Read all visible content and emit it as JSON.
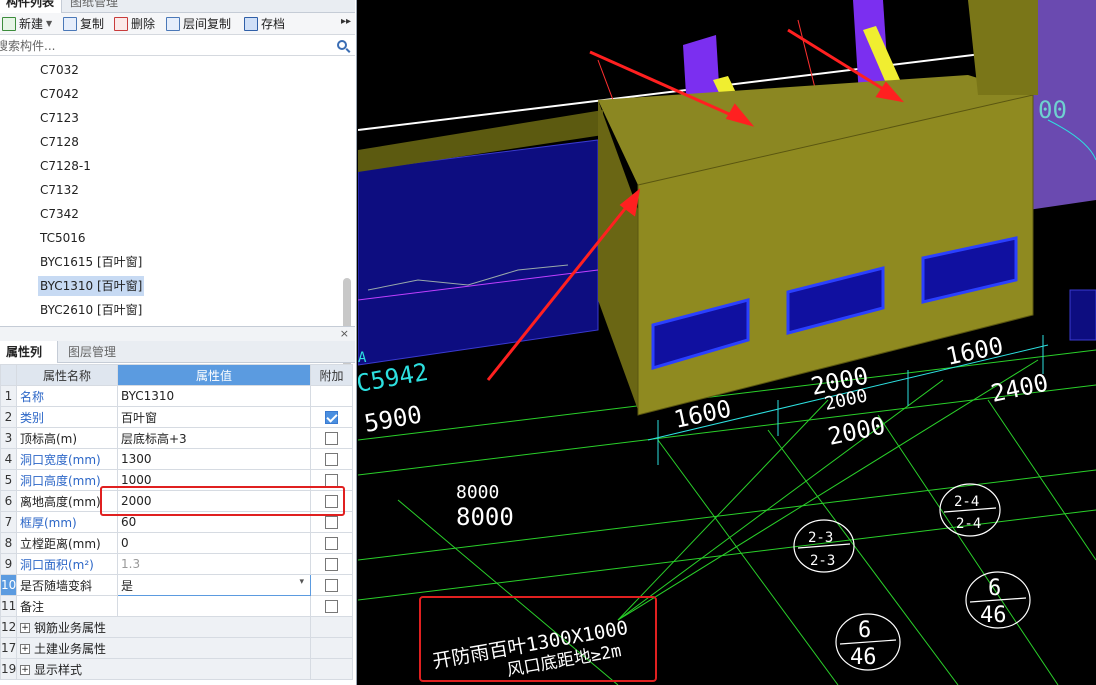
{
  "top_tabs": {
    "tab1": "构件列表",
    "tab2": "图纸管理"
  },
  "toolbar": {
    "new_label": "新建",
    "copy_label": "复制",
    "delete_label": "删除",
    "floor_copy_label": "层间复制",
    "save_label": "存档",
    "more": "▸▸"
  },
  "search": {
    "placeholder": "搜索构件..."
  },
  "components": [
    "C7032",
    "C7042",
    "C7123",
    "C7128",
    "C7128-1",
    "C7132",
    "C7342",
    "TC5016",
    "BYC1615 [百叶窗]",
    "BYC1310 [百叶窗]",
    "BYC2610 [百叶窗]"
  ],
  "selected_component": "BYC1310 [百叶窗]",
  "panel_close": "×",
  "prop_tabs": {
    "tab1": "属性列表",
    "tab2": "图层管理"
  },
  "prop_headers": {
    "name": "属性名称",
    "value": "属性值",
    "extra": "附加"
  },
  "props": [
    {
      "num": "1",
      "name": "名称",
      "value": "BYC1310"
    },
    {
      "num": "2",
      "name": "类别",
      "value": "百叶窗"
    },
    {
      "num": "3",
      "name": "顶标高(m)",
      "value": "层底标高+3"
    },
    {
      "num": "4",
      "name": "洞口宽度(mm)",
      "value": "1300"
    },
    {
      "num": "5",
      "name": "洞口高度(mm)",
      "value": "1000"
    },
    {
      "num": "6",
      "name": "离地高度(mm)",
      "value": "2000"
    },
    {
      "num": "7",
      "name": "框厚(mm)",
      "value": "60"
    },
    {
      "num": "8",
      "name": "立樘距离(mm)",
      "value": "0"
    },
    {
      "num": "9",
      "name": "洞口面积(m²)",
      "value": "1.3"
    },
    {
      "num": "10",
      "name": "是否随墙变斜",
      "value": "是"
    },
    {
      "num": "11",
      "name": "备注",
      "value": ""
    }
  ],
  "prop_groups": [
    {
      "num": "12",
      "name": "钢筋业务属性",
      "toggle": "+"
    },
    {
      "num": "17",
      "name": "土建业务属性",
      "toggle": "+"
    },
    {
      "num": "19",
      "name": "显示样式",
      "toggle": "+"
    }
  ],
  "cad": {
    "dims": [
      "1600",
      "2000",
      "2000",
      "2000",
      "1600",
      "2400",
      "5900",
      "C5942",
      "8000",
      "8000",
      "00"
    ],
    "tags": [
      "2-3",
      "2-3",
      "2-4",
      "2-4",
      "6",
      "46",
      "6",
      "46"
    ],
    "annotation_line1": "开防雨百叶1300X1000",
    "annotation_line2": "风口底距地≥2m",
    "marker": "A"
  }
}
